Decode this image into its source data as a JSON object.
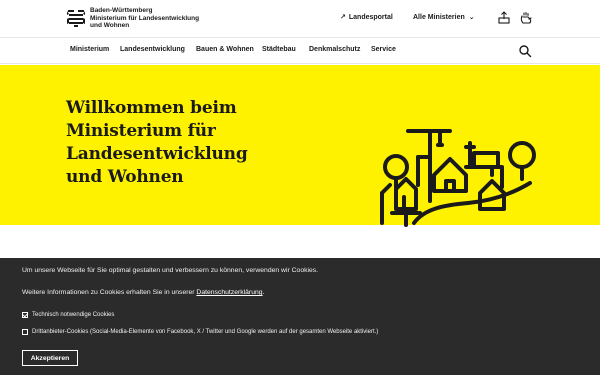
{
  "header": {
    "logo_lines": [
      "Baden-Württemberg",
      "Ministerium für Landesentwicklung",
      "und Wohnen"
    ],
    "landesportal_label": "Landesportal",
    "alle_ministerien_label": "Alle Ministerien",
    "icons": [
      "share-icon",
      "sign-language-icon"
    ]
  },
  "nav": {
    "items": [
      "Ministerium",
      "Landesentwicklung",
      "Bauen & Wohnen",
      "Städtebau",
      "Denkmalschutz",
      "Service"
    ],
    "search_icon": "search-icon"
  },
  "hero": {
    "title_lines": [
      "Willkommen beim",
      "Ministerium für",
      "Landesentwicklung",
      "und Wohnen"
    ],
    "background": "#fff200"
  },
  "cookie": {
    "line1": "Um unsere Webseite für Sie optimal gestalten und verbessern zu können, verwenden wir Cookies.",
    "line2_prefix": "Weitere Informationen zu Cookies erhalten Sie in unserer ",
    "line2_link": "Datenschutzerklärung",
    "line2_suffix": ".",
    "option_technical": "Technisch notwendige Cookies",
    "option_third_party": "Drittanbieter-Cookies (Social-Media-Elemente von Facebook, X / Twitter und Google werden auf der gesamten Webseite aktiviert.)",
    "option_technical_checked": true,
    "option_third_party_checked": false,
    "accept_label": "Akzeptieren",
    "background": "#2b2b2b"
  }
}
